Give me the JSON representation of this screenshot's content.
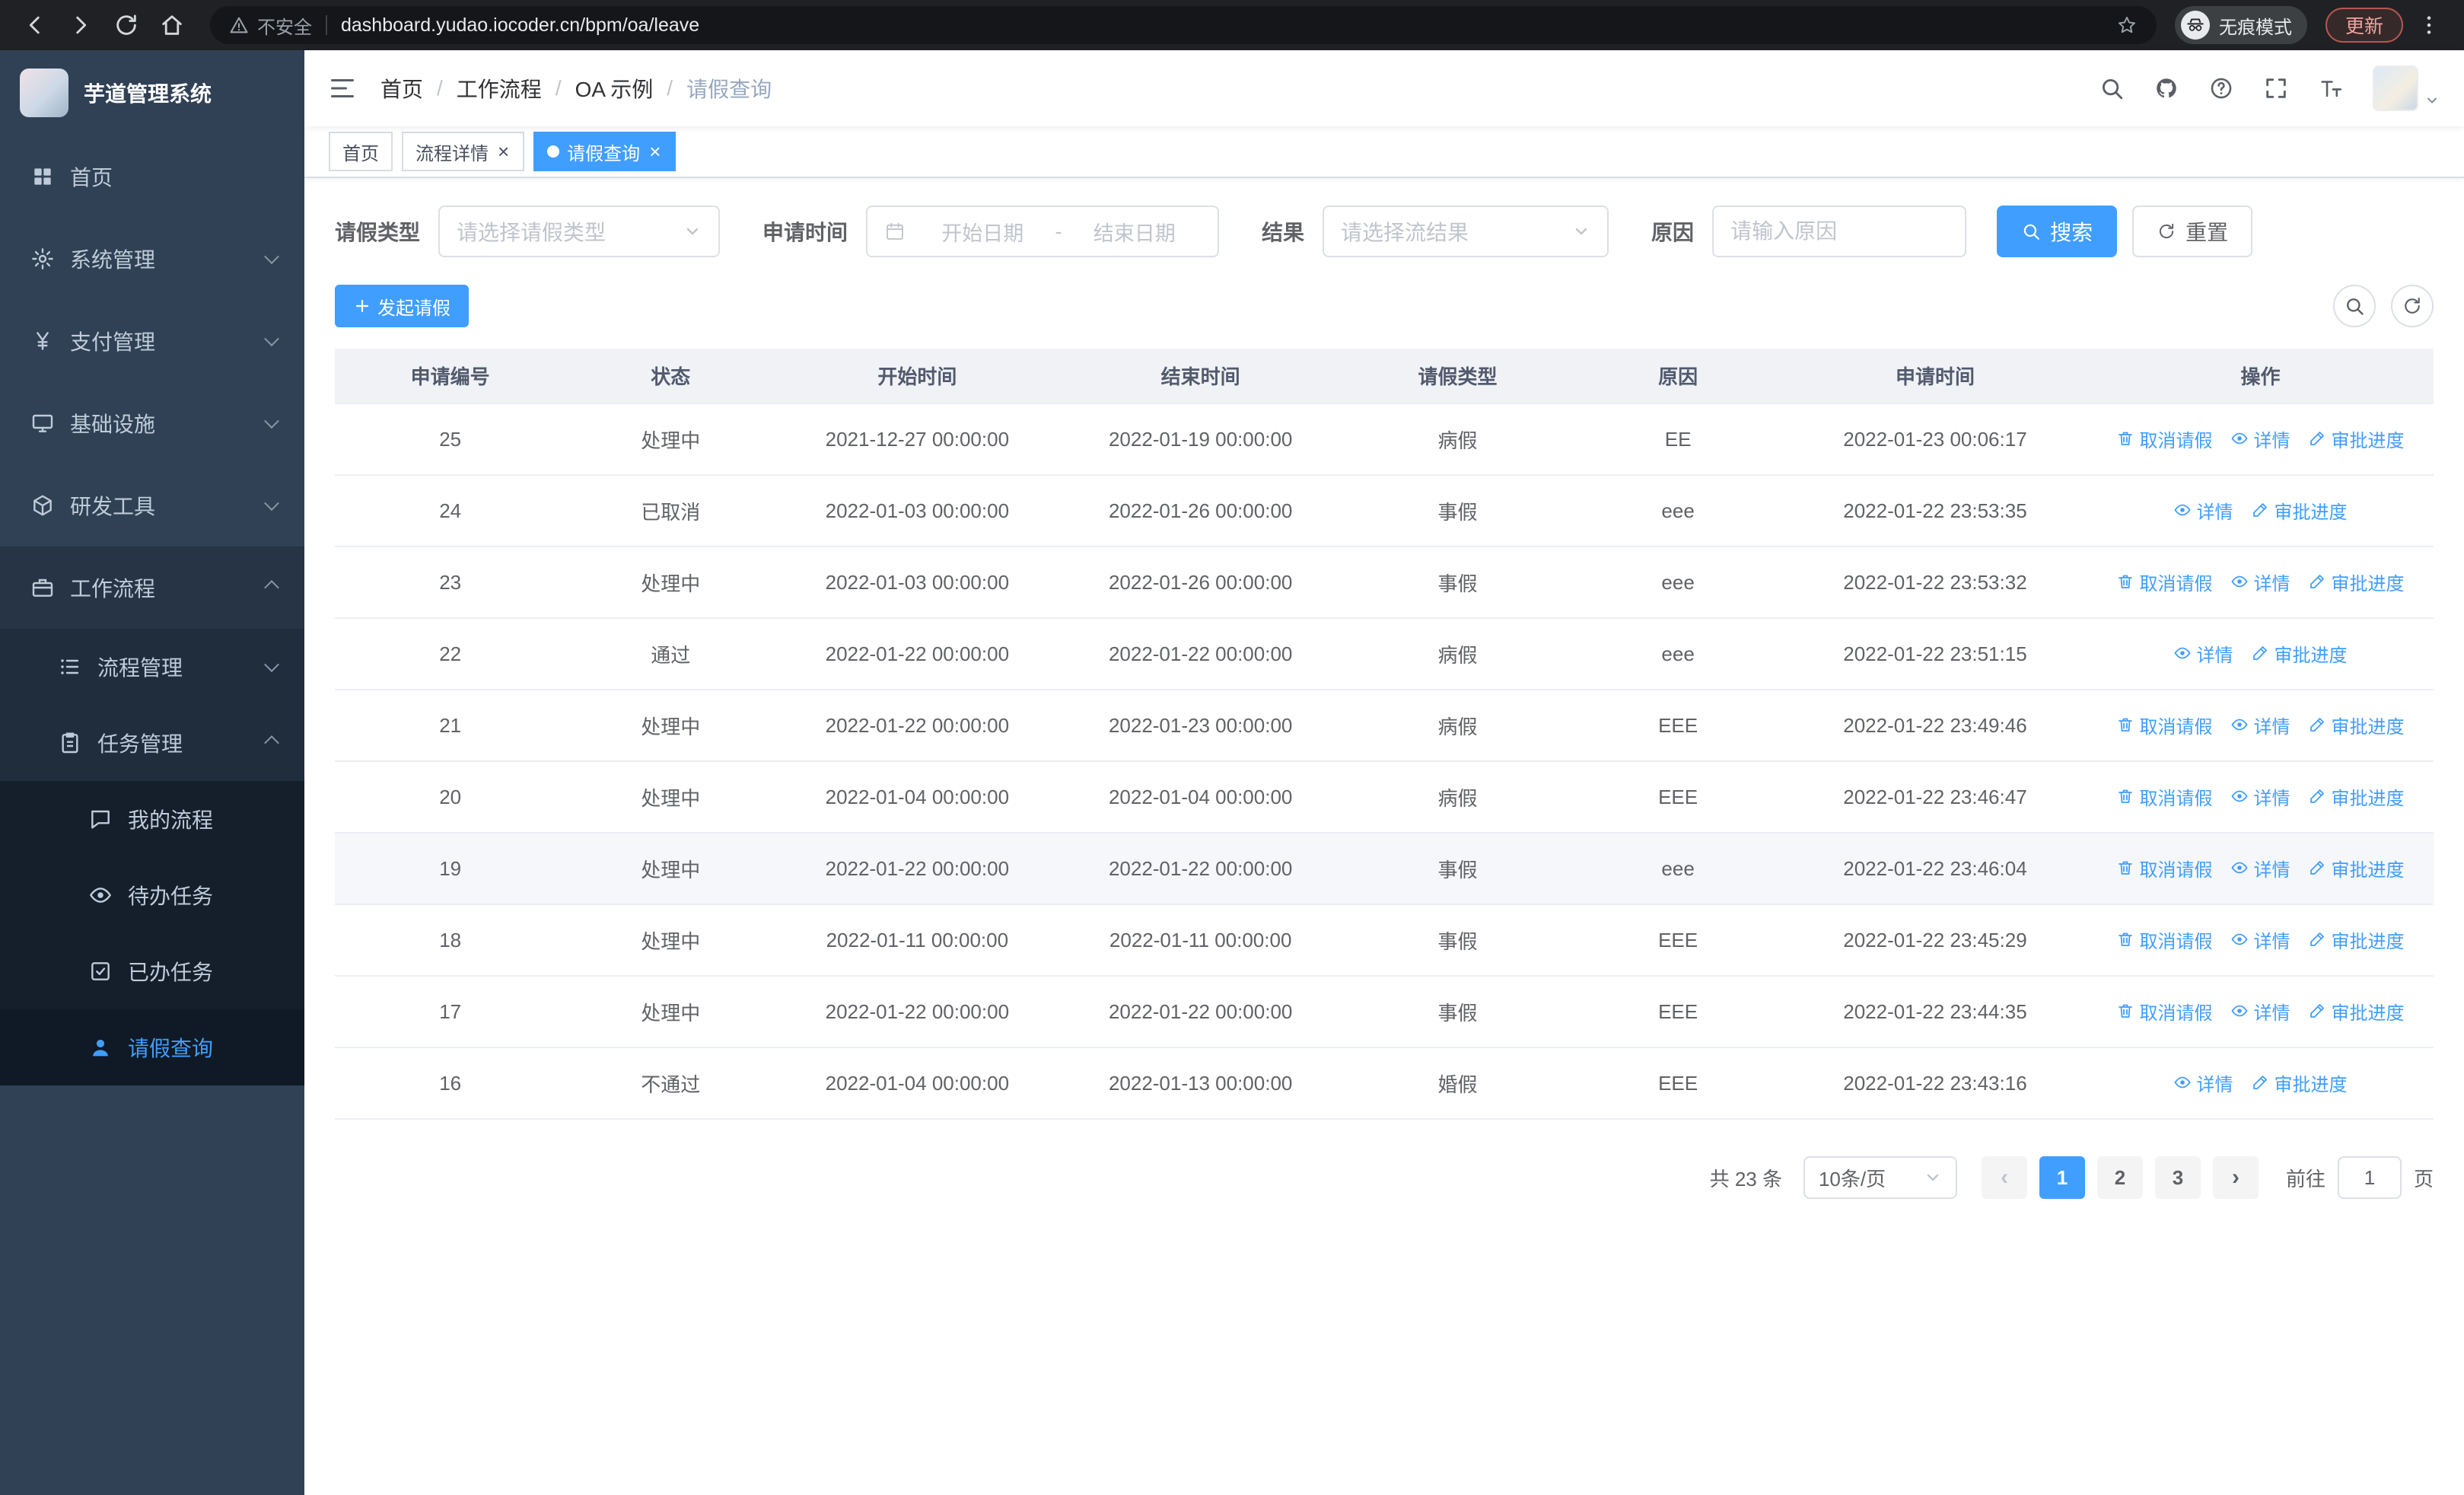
{
  "browser": {
    "nav_buttons": [
      {
        "name": "browser-back-button",
        "icon": "back"
      },
      {
        "name": "browser-forward-button",
        "icon": "forward"
      },
      {
        "name": "browser-reload-button",
        "icon": "reload"
      },
      {
        "name": "browser-home-button",
        "icon": "home"
      }
    ],
    "security_label": "不安全",
    "url": "dashboard.yudao.iocoder.cn/bpm/oa/leave",
    "incognito_label": "无痕模式",
    "update_label": "更新"
  },
  "sidebar": {
    "app_title": "芋道管理系统",
    "items": [
      {
        "label": "首页",
        "icon": "dashboard",
        "level": 1
      },
      {
        "label": "系统管理",
        "icon": "gear",
        "level": 1,
        "chevron": "down"
      },
      {
        "label": "支付管理",
        "icon": "yen",
        "level": 1,
        "chevron": "down"
      },
      {
        "label": "基础设施",
        "icon": "monitor",
        "level": 1,
        "chevron": "down"
      },
      {
        "label": "研发工具",
        "icon": "cube",
        "level": 1,
        "chevron": "down"
      },
      {
        "label": "工作流程",
        "icon": "briefcase",
        "level": 1,
        "chevron": "up",
        "expanded": true
      },
      {
        "label": "流程管理",
        "icon": "list",
        "level": 2,
        "chevron": "down"
      },
      {
        "label": "任务管理",
        "icon": "clipboard",
        "level": 2,
        "chevron": "up",
        "expanded": true
      },
      {
        "label": "我的流程",
        "icon": "chat",
        "level": 3
      },
      {
        "label": "待办任务",
        "icon": "eye",
        "level": 3
      },
      {
        "label": "已办任务",
        "icon": "check",
        "level": 3
      },
      {
        "label": "请假查询",
        "icon": "user",
        "level": 3,
        "active": true
      }
    ]
  },
  "navbar": {
    "breadcrumb": [
      "首页",
      "工作流程",
      "OA 示例",
      "请假查询"
    ],
    "icons": [
      {
        "name": "header-search-button",
        "icon": "search"
      },
      {
        "name": "github-button",
        "icon": "github"
      },
      {
        "name": "help-button",
        "icon": "question"
      },
      {
        "name": "fullscreen-button",
        "icon": "fullscreen"
      },
      {
        "name": "font-size-button",
        "icon": "fontsize"
      }
    ]
  },
  "tabs": [
    {
      "label": "首页",
      "closable": false,
      "active": false
    },
    {
      "label": "流程详情",
      "closable": true,
      "active": false
    },
    {
      "label": "请假查询",
      "closable": true,
      "active": true
    }
  ],
  "filters": {
    "leave_type_label": "请假类型",
    "leave_type_placeholder": "请选择请假类型",
    "apply_time_label": "申请时间",
    "start_placeholder": "开始日期",
    "range_separator": "-",
    "end_placeholder": "结束日期",
    "result_label": "结果",
    "result_placeholder": "请选择流结果",
    "reason_label": "原因",
    "reason_placeholder": "请输入原因",
    "search_label": "搜索",
    "reset_label": "重置"
  },
  "toolbar": {
    "create_label": "发起请假"
  },
  "table": {
    "columns": [
      "申请编号",
      "状态",
      "开始时间",
      "结束时间",
      "请假类型",
      "原因",
      "申请时间",
      "操作"
    ],
    "column_keys": [
      "id",
      "status",
      "start",
      "end",
      "type",
      "reason",
      "apply_time"
    ],
    "action_defs": {
      "cancel": {
        "label": "取消请假",
        "icon": "trash"
      },
      "detail": {
        "label": "详情",
        "icon": "eye"
      },
      "progress": {
        "label": "审批进度",
        "icon": "edit"
      }
    },
    "rows": [
      {
        "id": "25",
        "status": "处理中",
        "start": "2021-12-27 00:00:00",
        "end": "2022-01-19 00:00:00",
        "type": "病假",
        "reason": "EE",
        "apply_time": "2022-01-23 00:06:17",
        "actions": [
          "cancel",
          "detail",
          "progress"
        ]
      },
      {
        "id": "24",
        "status": "已取消",
        "start": "2022-01-03 00:00:00",
        "end": "2022-01-26 00:00:00",
        "type": "事假",
        "reason": "eee",
        "apply_time": "2022-01-22 23:53:35",
        "actions": [
          "detail",
          "progress"
        ]
      },
      {
        "id": "23",
        "status": "处理中",
        "start": "2022-01-03 00:00:00",
        "end": "2022-01-26 00:00:00",
        "type": "事假",
        "reason": "eee",
        "apply_time": "2022-01-22 23:53:32",
        "actions": [
          "cancel",
          "detail",
          "progress"
        ]
      },
      {
        "id": "22",
        "status": "通过",
        "start": "2022-01-22 00:00:00",
        "end": "2022-01-22 00:00:00",
        "type": "病假",
        "reason": "eee",
        "apply_time": "2022-01-22 23:51:15",
        "actions": [
          "detail",
          "progress"
        ]
      },
      {
        "id": "21",
        "status": "处理中",
        "start": "2022-01-22 00:00:00",
        "end": "2022-01-23 00:00:00",
        "type": "病假",
        "reason": "EEE",
        "apply_time": "2022-01-22 23:49:46",
        "actions": [
          "cancel",
          "detail",
          "progress"
        ]
      },
      {
        "id": "20",
        "status": "处理中",
        "start": "2022-01-04 00:00:00",
        "end": "2022-01-04 00:00:00",
        "type": "病假",
        "reason": "EEE",
        "apply_time": "2022-01-22 23:46:47",
        "actions": [
          "cancel",
          "detail",
          "progress"
        ]
      },
      {
        "id": "19",
        "status": "处理中",
        "start": "2022-01-22 00:00:00",
        "end": "2022-01-22 00:00:00",
        "type": "事假",
        "reason": "eee",
        "apply_time": "2022-01-22 23:46:04",
        "actions": [
          "cancel",
          "detail",
          "progress"
        ],
        "highlighted": true
      },
      {
        "id": "18",
        "status": "处理中",
        "start": "2022-01-11 00:00:00",
        "end": "2022-01-11 00:00:00",
        "type": "事假",
        "reason": "EEE",
        "apply_time": "2022-01-22 23:45:29",
        "actions": [
          "cancel",
          "detail",
          "progress"
        ]
      },
      {
        "id": "17",
        "status": "处理中",
        "start": "2022-01-22 00:00:00",
        "end": "2022-01-22 00:00:00",
        "type": "事假",
        "reason": "EEE",
        "apply_time": "2022-01-22 23:44:35",
        "actions": [
          "cancel",
          "detail",
          "progress"
        ]
      },
      {
        "id": "16",
        "status": "不通过",
        "start": "2022-01-04 00:00:00",
        "end": "2022-01-13 00:00:00",
        "type": "婚假",
        "reason": "EEE",
        "apply_time": "2022-01-22 23:43:16",
        "actions": [
          "detail",
          "progress"
        ]
      }
    ]
  },
  "pagination": {
    "total_label": "共 23 条",
    "page_size": "10条/页",
    "pages": [
      "1",
      "2",
      "3"
    ],
    "active_page": "1",
    "prev_symbol": "‹",
    "next_symbol": "›",
    "goto_label": "前往",
    "goto_value": "1",
    "page_unit": "页"
  },
  "accent_colors": {
    "primary": "#409eff",
    "sidebar_bg": "#304156",
    "submenu_bg": "#1f2d3d",
    "chrome_bg": "#202124"
  }
}
